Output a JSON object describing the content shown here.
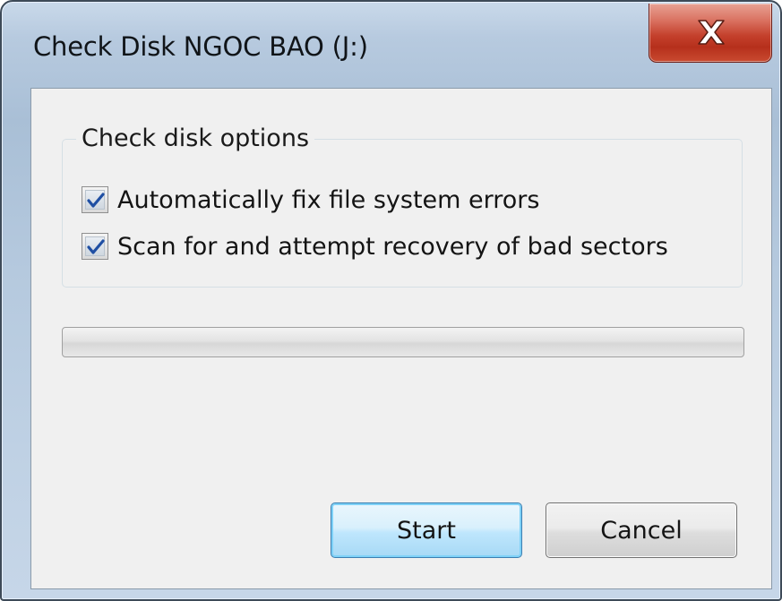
{
  "window": {
    "title": "Check Disk NGOC BAO (J:)",
    "close_icon": "close-x-icon"
  },
  "options_group": {
    "label": "Check disk options",
    "options": [
      {
        "label": "Automatically fix file system errors",
        "checked": true
      },
      {
        "label": "Scan for and attempt recovery of bad sectors",
        "checked": true
      }
    ]
  },
  "progress": {
    "value_percent": 0
  },
  "buttons": {
    "start_label": "Start",
    "cancel_label": "Cancel"
  },
  "colors": {
    "close_button": "#c4402c",
    "checkmark": "#1f4fa3",
    "default_button_border": "#3c7fb1"
  }
}
